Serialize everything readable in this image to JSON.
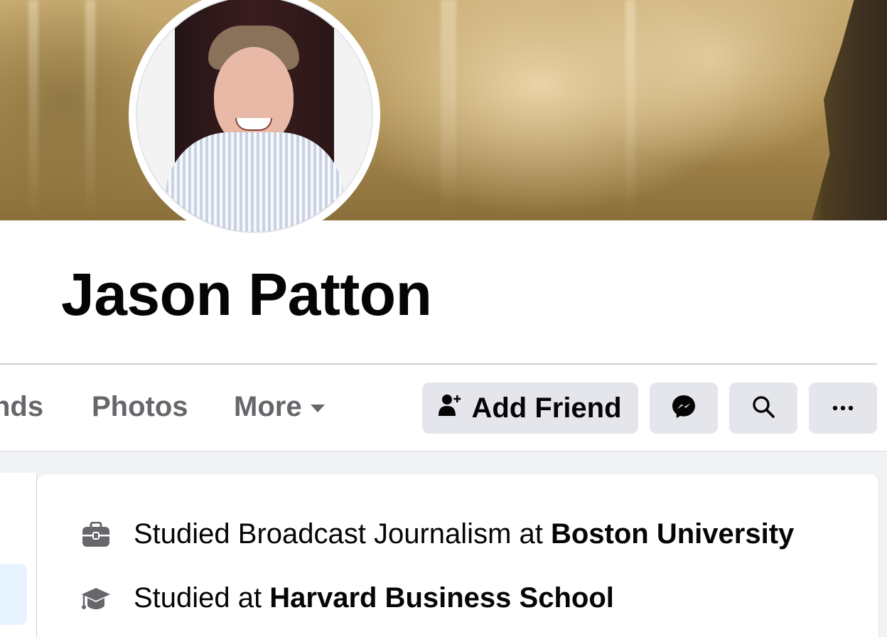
{
  "profile": {
    "name": "Jason Patton"
  },
  "tabs": {
    "friends_partial": "nds",
    "photos": "Photos",
    "more": "More"
  },
  "actions": {
    "add_friend_label": "Add Friend"
  },
  "intro": {
    "work": {
      "prefix": "Studied Broadcast Journalism at ",
      "place": "Boston University",
      "icon": "briefcase-icon"
    },
    "education": {
      "prefix": "Studied at ",
      "place": "Harvard Business School",
      "icon": "graduation-cap-icon"
    }
  },
  "colors": {
    "button_bg": "#e4e6eb",
    "tab_text": "#65676b",
    "page_bg": "#f0f2f5",
    "icon_gray": "#65676b"
  }
}
